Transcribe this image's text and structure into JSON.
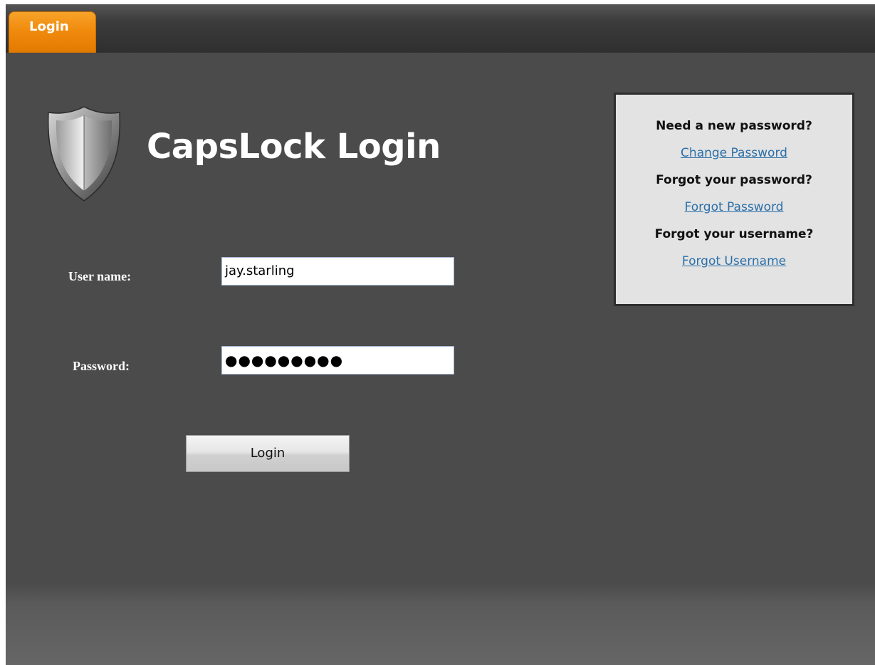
{
  "tabs": [
    {
      "label": "Login",
      "active": true,
      "color": "#F08A0C"
    }
  ],
  "header": {
    "title": "CapsLock Login",
    "logo_icon": "shield-icon"
  },
  "form": {
    "username_label": "User name:",
    "username_value": "jay.starling",
    "password_label": "Password:",
    "password_masked": "●●●●●●●●●",
    "login_button": "Login"
  },
  "help": {
    "q_new_password": "Need a new password?",
    "link_change_password": "Change Password",
    "q_forgot_password": "Forgot your password?",
    "link_forgot_password": "Forgot Password",
    "q_forgot_username": "Forgot your username?",
    "link_forgot_username": "Forgot Username",
    "link_color": "#2A6FA8"
  }
}
